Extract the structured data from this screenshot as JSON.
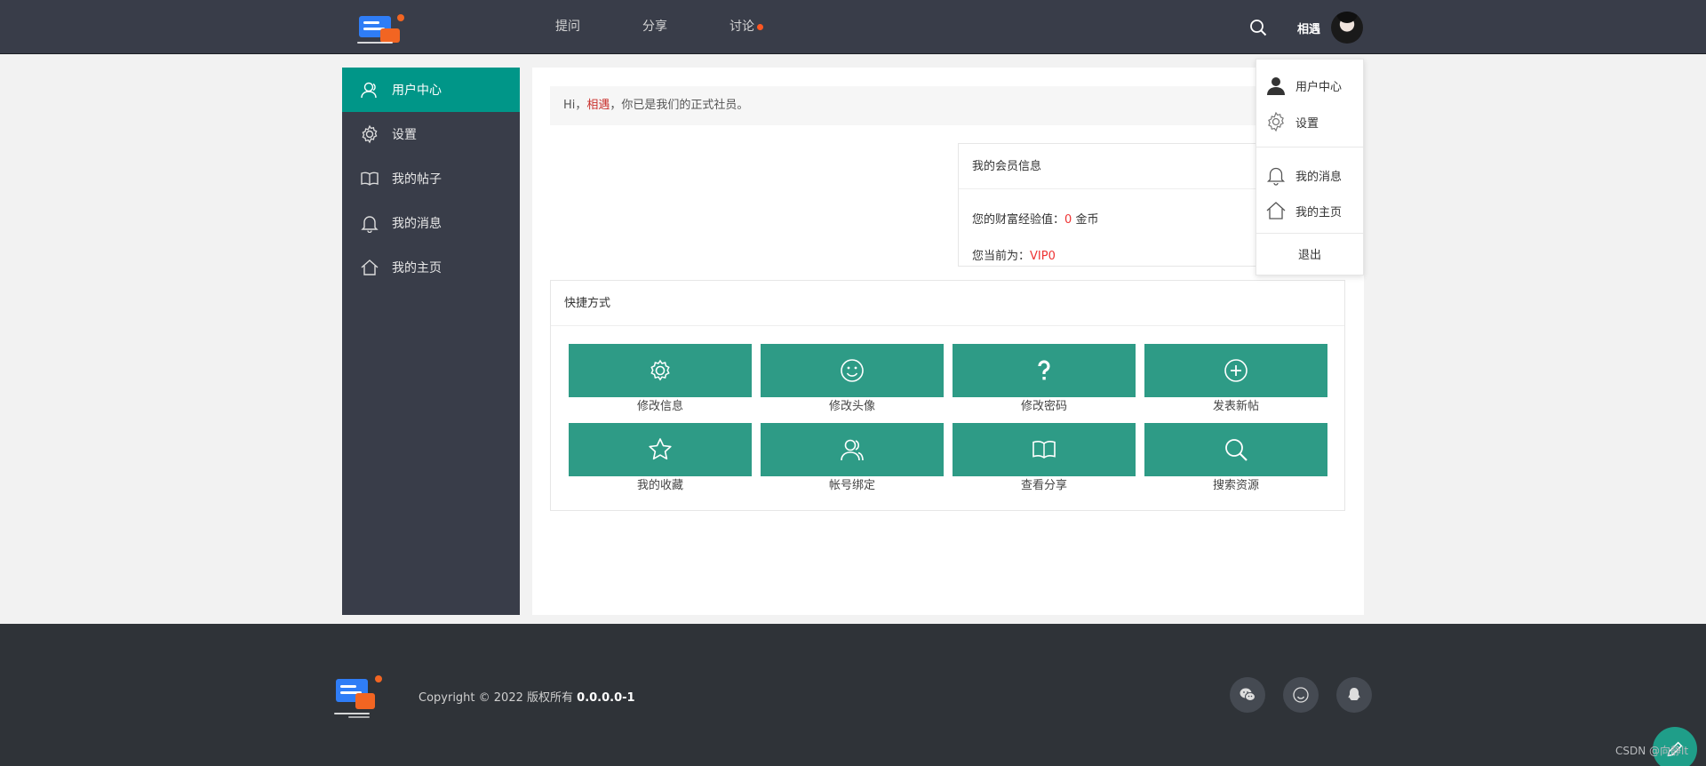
{
  "header": {
    "nav": [
      {
        "label": "提问",
        "has_dot": false
      },
      {
        "label": "分享",
        "has_dot": false
      },
      {
        "label": "讨论",
        "has_dot": true
      }
    ],
    "username": "相遇",
    "search_icon": "search-icon",
    "colors": {
      "bg": "#393d49",
      "dot": "#ff5722"
    }
  },
  "sidebar": {
    "items": [
      {
        "label": "用户中心",
        "icon": "user-icon",
        "active": true
      },
      {
        "label": "设置",
        "icon": "gear-icon",
        "active": false
      },
      {
        "label": "我的帖子",
        "icon": "book-icon",
        "active": false
      },
      {
        "label": "我的消息",
        "icon": "bell-icon",
        "active": false
      },
      {
        "label": "我的主页",
        "icon": "home-icon",
        "active": false
      }
    ],
    "colors": {
      "bg": "#393d49",
      "active": "#009688"
    }
  },
  "greeting": {
    "prefix": "Hi，",
    "name": "相遇",
    "suffix": "，你已是我们的正式社员。"
  },
  "member": {
    "title": "我的会员信息",
    "wealth_label": "您的财富经验值：",
    "wealth_value": "0",
    "wealth_unit": "金币",
    "vip_label": "您当前为：",
    "vip_value": "VIP0"
  },
  "shortcuts": {
    "title": "快捷方式",
    "items": [
      {
        "label": "修改信息",
        "icon": "gear-icon"
      },
      {
        "label": "修改头像",
        "icon": "smile-icon"
      },
      {
        "label": "修改密码",
        "icon": "question-icon"
      },
      {
        "label": "发表新帖",
        "icon": "plus-circle-icon"
      },
      {
        "label": "我的收藏",
        "icon": "star-icon"
      },
      {
        "label": "帐号绑定",
        "icon": "users-icon"
      },
      {
        "label": "查看分享",
        "icon": "book-icon"
      },
      {
        "label": "搜索资源",
        "icon": "search-icon"
      }
    ],
    "tile_color": "#2e9b86"
  },
  "dropdown": {
    "items": [
      {
        "label": "用户中心",
        "icon": "user-icon"
      },
      {
        "label": "设置",
        "icon": "gear-icon"
      },
      {
        "label": "我的消息",
        "icon": "bell-icon"
      },
      {
        "label": "我的主页",
        "icon": "home-icon"
      }
    ],
    "logout": "退出"
  },
  "footer": {
    "copyright_text": "Copyright © 2022 版权所有",
    "version": "0.0.0.0-1",
    "icons": [
      "wechat-icon",
      "smile-icon",
      "qq-icon"
    ],
    "watermark": "CSDN @向静lt"
  }
}
